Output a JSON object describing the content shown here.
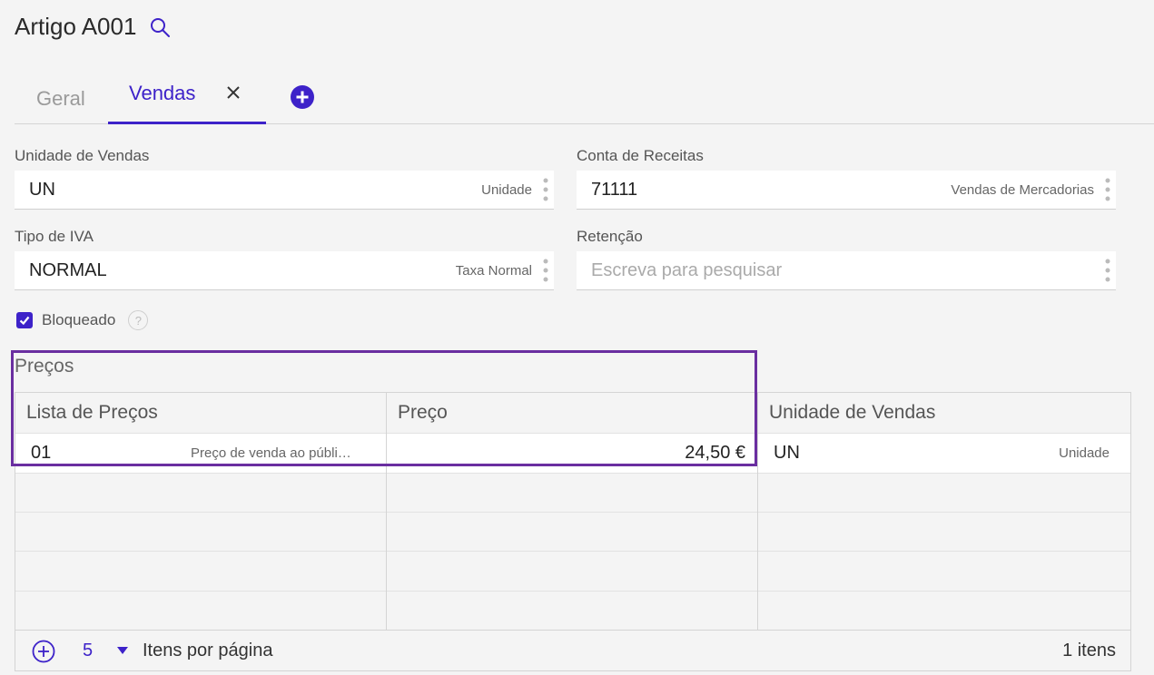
{
  "page": {
    "title": "Artigo A001"
  },
  "tabs": [
    {
      "label": "Geral",
      "active": false
    },
    {
      "label": "Vendas",
      "active": true
    }
  ],
  "fields": {
    "sales_unit": {
      "label": "Unidade de Vendas",
      "value": "UN",
      "description": "Unidade"
    },
    "revenue_account": {
      "label": "Conta de Receitas",
      "value": "71111",
      "description": "Vendas de Mercadorias"
    },
    "vat_type": {
      "label": "Tipo de IVA",
      "value": "NORMAL",
      "description": "Taxa Normal"
    },
    "withholding": {
      "label": "Retenção",
      "value": "",
      "placeholder": "Escreva para pesquisar"
    }
  },
  "blocked": {
    "label": "Bloqueado",
    "checked": true,
    "help": "?"
  },
  "prices": {
    "title": "Preços",
    "columns": [
      "Lista de Preços",
      "Preço",
      "Unidade de Vendas"
    ],
    "rows": [
      {
        "code": "01",
        "description": "Preço de venda ao públi…",
        "price": "24,50 €",
        "unit": "UN",
        "unit_desc": "Unidade"
      }
    ],
    "footer": {
      "page_size": "5",
      "items_per_page_label": "Itens por página",
      "count_label": "1 itens"
    }
  },
  "colors": {
    "accent": "#3d22c9",
    "highlight": "#6a2ea0",
    "background": "#f4f4f4"
  }
}
